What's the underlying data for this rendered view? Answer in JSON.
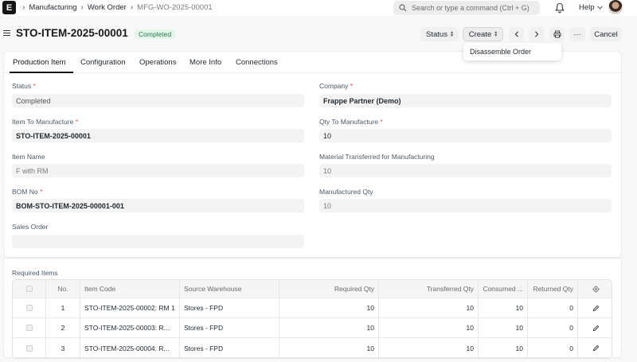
{
  "navbar": {
    "logo": "E",
    "breadcrumbs": [
      "Manufacturing",
      "Work Order",
      "MFG-WO-2025-00001"
    ],
    "search_placeholder": "Search or type a command (Ctrl + G)",
    "help_label": "Help"
  },
  "header": {
    "title": "STO-ITEM-2025-00001",
    "status_badge": "Completed",
    "status_button": "Status",
    "create_button": "Create",
    "more_button": "···",
    "cancel_button": "Cancel",
    "dropdown_item": "Disassemble Order"
  },
  "tabs": [
    "Production Item",
    "Configuration",
    "Operations",
    "More Info",
    "Connections"
  ],
  "fields": {
    "status": {
      "label": "Status",
      "value": "Completed"
    },
    "company": {
      "label": "Company",
      "value": "Frappe Partner (Demo)"
    },
    "item_to_manufacture": {
      "label": "Item To Manufacture",
      "value": "STO-ITEM-2025-00001"
    },
    "qty_to_manufacture": {
      "label": "Qty To Manufacture",
      "value": "10"
    },
    "item_name": {
      "label": "Item Name",
      "value": "F with RM"
    },
    "material_transferred": {
      "label": "Material Transferred for Manufacturing",
      "value": "10"
    },
    "bom_no": {
      "label": "BOM No",
      "value": "BOM-STO-ITEM-2025-00001-001"
    },
    "manufactured_qty": {
      "label": "Manufactured Qty",
      "value": "10"
    },
    "sales_order": {
      "label": "Sales Order",
      "value": ""
    }
  },
  "required_items": {
    "title": "Required Items",
    "columns": [
      "No.",
      "Item Code",
      "Source Warehouse",
      "Required Qty",
      "Transferred Qty",
      "Consumed ...",
      "Returned Qty"
    ],
    "rows": [
      {
        "no": "1",
        "item_code": "STO-ITEM-2025-00002: RM 1",
        "warehouse": "Stores - FPD",
        "required": "10",
        "transferred": "10",
        "consumed": "10",
        "returned": "0"
      },
      {
        "no": "2",
        "item_code": "STO-ITEM-2025-00003: R...",
        "warehouse": "Stores - FPD",
        "required": "10",
        "transferred": "10",
        "consumed": "10",
        "returned": "0"
      },
      {
        "no": "3",
        "item_code": "STO-ITEM-2025-00004: R...",
        "warehouse": "Stores - FPD",
        "required": "10",
        "transferred": "10",
        "consumed": "10",
        "returned": "0"
      }
    ]
  }
}
